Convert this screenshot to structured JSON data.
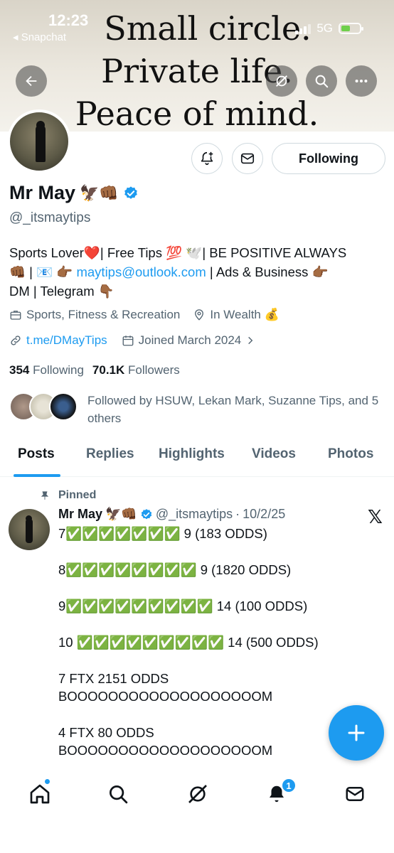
{
  "status_bar": {
    "time": "12:23",
    "back_app": "◂ Snapchat",
    "network": "5G"
  },
  "banner": {
    "line1": "Small circle.",
    "line2": "Private life.",
    "line3": "Peace of mind."
  },
  "profile": {
    "name": "Mr May",
    "name_emojis": "🦅👊🏾",
    "handle": "@_itsmaytips",
    "following_button": "Following",
    "bio": {
      "line1": "Sports Lover❤️| Free Tips 💯 🕊️| BE POSITIVE ALWAYS",
      "line2_prefix": "👊🏾 | 📧 👉🏾 ",
      "email": "maytips@outlook.com",
      "line2_suffix": " | Ads & Business 👉🏾",
      "line3": "DM | Telegram 👇🏾"
    },
    "category": "Sports, Fitness & Recreation",
    "location": "In Wealth 💰",
    "website": "t.me/DMayTips",
    "joined": "Joined March 2024",
    "following_count": "354",
    "following_label": "Following",
    "followers_count": "70.1K",
    "followers_label": "Followers",
    "followed_by": "Followed by HSUW, Lekan Mark, Suzanne Tips, and 5 others"
  },
  "tabs": [
    "Posts",
    "Replies",
    "Highlights",
    "Videos",
    "Photos"
  ],
  "post": {
    "pinned_label": "Pinned",
    "author_name": "Mr May",
    "author_emojis": "🦅👊🏾",
    "author_handle": "@_itsmaytips",
    "date": "10/2/25",
    "lines": [
      "7✅✅✅✅✅✅✅ 9 (183 ODDS)",
      "8✅✅✅✅✅✅✅✅ 9 (1820 ODDS)",
      "9✅✅✅✅✅✅✅✅✅ 14 (100 ODDS)",
      "10 ✅✅✅✅✅✅✅✅✅ 14 (500 ODDS)",
      "7 FTX 2151 ODDS",
      "BOOOOOOOOOOOOOOOOOOOM",
      "4 FTX 80 ODDS",
      "BOOOOOOOOOOOOOOOOOOOM"
    ]
  },
  "nav": {
    "notifications_badge": "1"
  },
  "colors": {
    "accent": "#1d9bf0",
    "text": "#0f1419",
    "secondary": "#536471"
  }
}
